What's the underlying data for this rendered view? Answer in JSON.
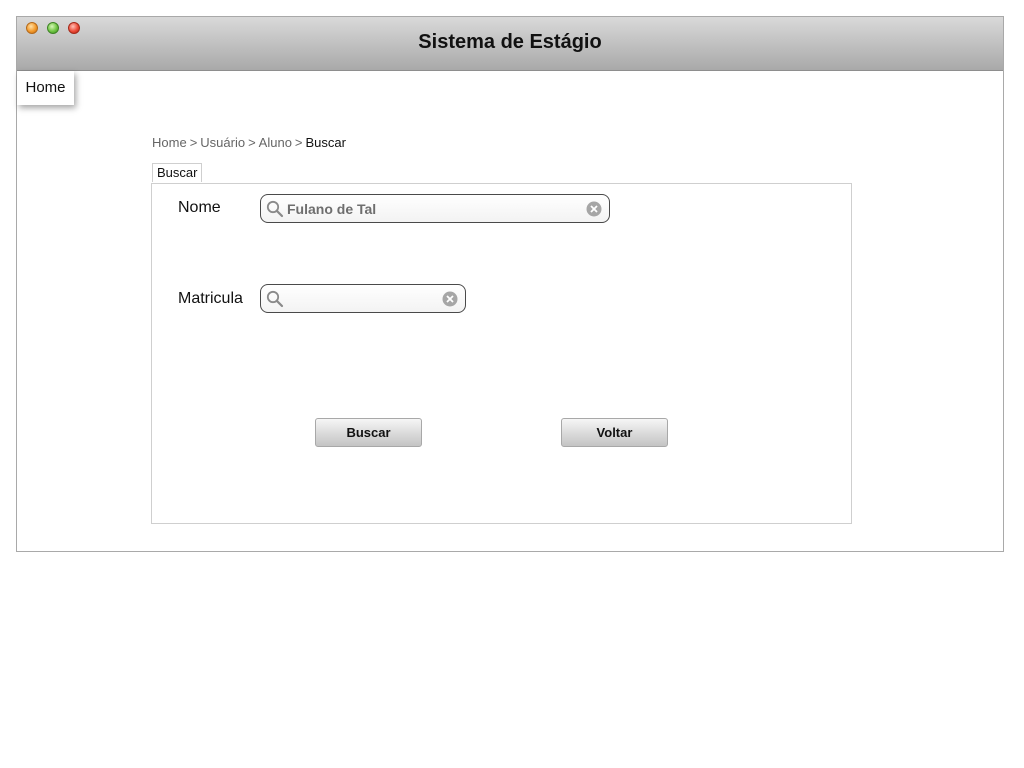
{
  "window": {
    "title": "Sistema de Estágio"
  },
  "nav": {
    "home_label": "Home"
  },
  "breadcrumb": {
    "items": [
      "Home",
      "Usuário",
      "Aluno"
    ],
    "separator": ">",
    "current": "Buscar"
  },
  "tab": {
    "label": "Buscar"
  },
  "form": {
    "nome": {
      "label": "Nome",
      "value": "Fulano de Tal",
      "icon": "search-icon"
    },
    "matricula": {
      "label": "Matricula",
      "value": "",
      "icon": "search-icon"
    }
  },
  "buttons": {
    "search_label": "Buscar",
    "back_label": "Voltar"
  },
  "colors": {
    "titlebar_top": "#d9d9d9",
    "titlebar_bottom": "#a9a9a9",
    "border": "#cfcfcf"
  }
}
